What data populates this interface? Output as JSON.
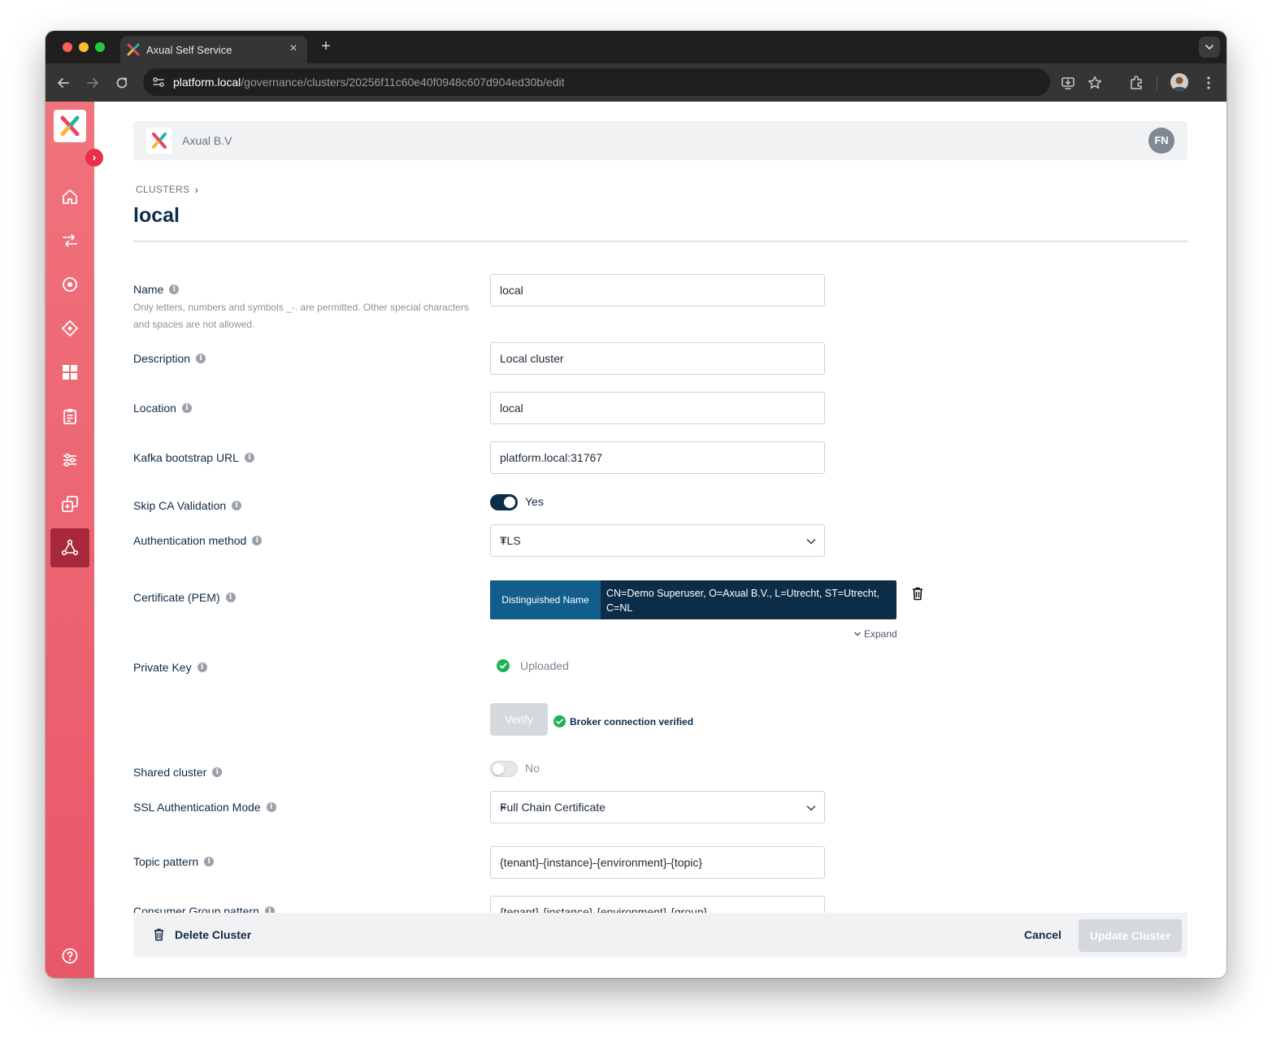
{
  "browser": {
    "tab_title": "Axual Self Service",
    "tab_close": "×",
    "new_tab": "+",
    "url_host": "platform.local",
    "url_path": "/governance/clusters/20256f11c60e40f0948c607d904ed30b/edit"
  },
  "sidebar": {
    "toggle_glyph": "›",
    "items": [
      {
        "icon": "home-icon"
      },
      {
        "icon": "streams-icon"
      },
      {
        "icon": "target-icon"
      },
      {
        "icon": "diamond-icon"
      },
      {
        "icon": "dashboard-icon"
      },
      {
        "icon": "clipboard-icon"
      },
      {
        "icon": "sliders-icon"
      },
      {
        "icon": "copy-icon"
      },
      {
        "icon": "cluster-icon",
        "active": true
      }
    ],
    "help_icon": "help-icon"
  },
  "header": {
    "org_name": "Axual B.V",
    "user_initials": "FN"
  },
  "breadcrumb": {
    "item": "CLUSTERS",
    "separator": "›"
  },
  "page_title": "local",
  "form": {
    "info_glyph": "i",
    "name": {
      "label": "Name",
      "hint": "Only letters, numbers and symbols _-. are permitted. Other special characters and spaces are not allowed.",
      "value": "local"
    },
    "description": {
      "label": "Description",
      "value": "Local cluster"
    },
    "location": {
      "label": "Location",
      "value": "local"
    },
    "bootstrap": {
      "label": "Kafka bootstrap URL",
      "value": "platform.local:31767"
    },
    "skip_ca": {
      "label": "Skip CA Validation",
      "value": "Yes",
      "enabled": true
    },
    "auth_method": {
      "label": "Authentication method",
      "value": "TLS",
      "clear_glyph": "×"
    },
    "certificate": {
      "label": "Certificate (PEM)",
      "tag": "Distinguished Name",
      "value": "CN=Demo Superuser, O=Axual B.V., L=Utrecht, ST=Utrecht, C=NL",
      "expand_label": "Expand"
    },
    "private_key": {
      "label": "Private Key",
      "status": "Uploaded"
    },
    "verify": {
      "button": "Verify",
      "status": "Broker connection verified"
    },
    "shared_cluster": {
      "label": "Shared cluster",
      "value": "No",
      "enabled": false
    },
    "ssl_mode": {
      "label": "SSL Authentication Mode",
      "value": "Full Chain Certificate",
      "clear_glyph": "×"
    },
    "topic_pattern": {
      "label": "Topic pattern",
      "value": "{tenant}-{instance}-{environment}-{topic}"
    },
    "consumer_group_pattern": {
      "label": "Consumer Group pattern",
      "value": "{tenant}-{instance}-{environment}-{group}"
    }
  },
  "footer": {
    "delete_label": "Delete Cluster",
    "cancel_label": "Cancel",
    "update_label": "Update Cluster"
  },
  "colors": {
    "navy": "#0c2d48",
    "sidebar_pink": "#f0737c",
    "sidebar_active": "#a7293b",
    "success_green": "#1fb255",
    "cert_tag_blue": "#115d8c"
  }
}
